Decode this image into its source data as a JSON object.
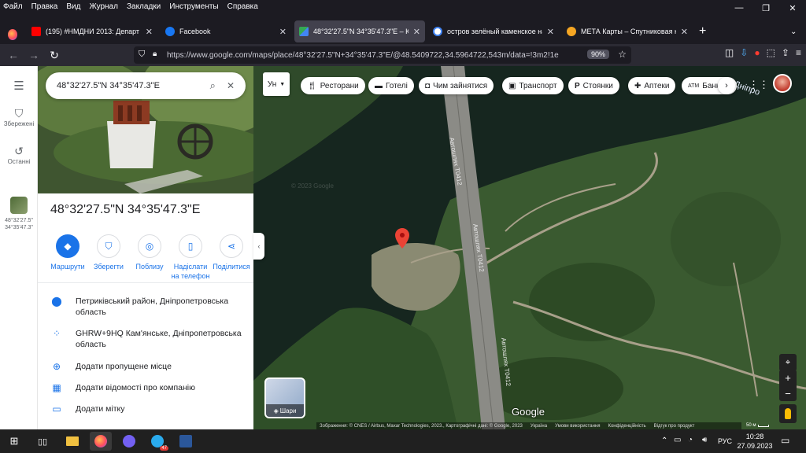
{
  "menu": [
    "Файл",
    "Правка",
    "Вид",
    "Журнал",
    "Закладки",
    "Инструменты",
    "Справка"
  ],
  "tabs": [
    {
      "title": "(195) #НМДНИ 2013: Департ",
      "favicon_color": "#ff0000",
      "icon": "youtube-icon"
    },
    {
      "title": "Facebook",
      "favicon_color": "#1877f2",
      "icon": "facebook-icon"
    },
    {
      "title": "48°32'27.5\"N 34°35'47.3\"E – Карт",
      "favicon_color": "#34a853",
      "icon": "google-maps-icon",
      "active": true
    },
    {
      "title": "остров зелёный каменское на",
      "favicon_color": "#4285f4",
      "icon": "google-icon"
    },
    {
      "title": "МЕТА Карты – Спутниковая к",
      "favicon_color": "#f5a623",
      "icon": "meta-maps-icon"
    }
  ],
  "new_tab_label": "+",
  "url": "https://www.google.com/maps/place/48°32'27.5\"N+34°35'47.3\"E/@48.5409722,34.5964722,543m/data=!3m2!1e",
  "zoom_level": "90%",
  "rail": {
    "menu_label": "",
    "saved_label": "Збережені",
    "recent_label": "Останні",
    "recent_item": "48°32'27.5\" 34°35'47.3\""
  },
  "search": {
    "value": "48°32'27.5\"N 34°35'47.3\"E"
  },
  "place": {
    "title": "48°32'27.5\"N 34°35'47.3\"E"
  },
  "actions": [
    {
      "label": "Маршрути",
      "icon": "directions-icon",
      "primary": true
    },
    {
      "label": "Зберегти",
      "icon": "bookmark-icon"
    },
    {
      "label": "Поблизу",
      "icon": "nearby-icon"
    },
    {
      "label": "Надіслати на телефон",
      "icon": "send-to-phone-icon"
    },
    {
      "label": "Поділитися",
      "icon": "share-icon"
    }
  ],
  "info": [
    {
      "text": "Петриківський район, Дніпропетровська область",
      "icon": "location-pin-icon"
    },
    {
      "text": "GHRW+9HQ Кам'янське, Дніпропетровська область",
      "icon": "plus-code-icon"
    },
    {
      "text": "Додати пропущене місце",
      "icon": "add-place-icon"
    },
    {
      "text": "Додати відомості про компанію",
      "icon": "add-business-icon"
    },
    {
      "text": "Додати мітку",
      "icon": "label-icon"
    }
  ],
  "map": {
    "language_button": "Ун",
    "chips": [
      {
        "label": "Ресторани",
        "icon": "restaurant-icon"
      },
      {
        "label": "Готелі",
        "icon": "hotel-icon"
      },
      {
        "label": "Чим зайнятися",
        "icon": "camera-icon"
      },
      {
        "label": "Транспорт",
        "icon": "transit-icon"
      },
      {
        "label": "Стоянки",
        "icon": "parking-icon"
      },
      {
        "label": "Аптеки",
        "icon": "pharmacy-icon"
      },
      {
        "label": "Банк",
        "icon": "bank-icon"
      }
    ],
    "road_labels": [
      "Автошлях Т0412",
      "Автошлях Т0412",
      "Автошлях Т0412"
    ],
    "river_label": "ка Дніпро",
    "layers_label": "Шари",
    "watermark": "Google",
    "copyright": "Зображення: © CNES / Airbus, Maxar Technologies, 2023., Картографічні дані: © Google, 2023",
    "footer_links": [
      "Україна",
      "Умови використання",
      "Конфіденційність",
      "Відгук про продукт"
    ],
    "scale_label": "50 м",
    "faint_label": "© 2023 Google"
  },
  "taskbar": {
    "time": "10:28",
    "date": "27.09.2023",
    "lang": "РУС",
    "badge": "47"
  }
}
